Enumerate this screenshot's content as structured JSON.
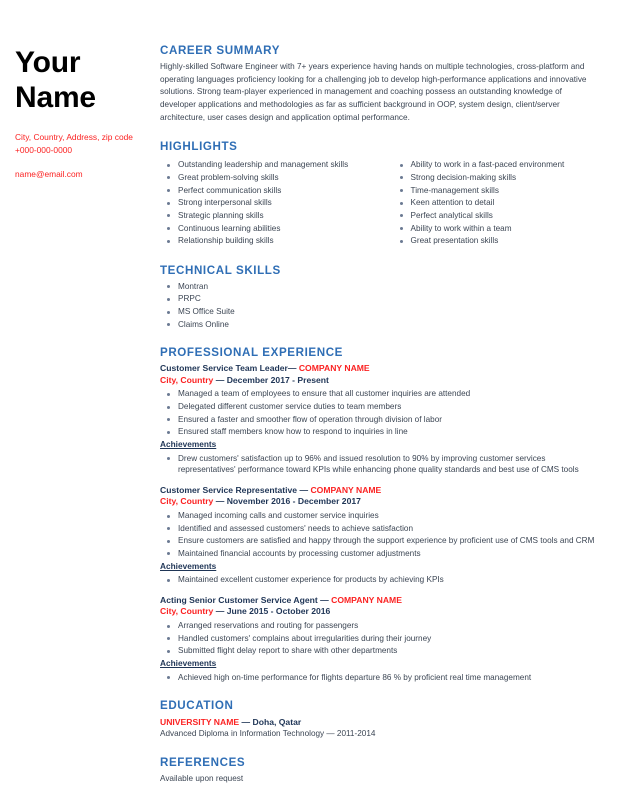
{
  "header": {
    "name_line_1": "Your",
    "name_line_2": "Name",
    "address": "City, Country, Address, zip code",
    "phone": "+000-000-0000",
    "email": "name@email.com"
  },
  "colors": {
    "heading_blue": "#2f6eb5",
    "accent_red": "#fb2222",
    "body_gray": "#3c4654",
    "dark_navy": "#1f3556"
  },
  "career_summary": {
    "title": "CAREER SUMMARY",
    "text": "Highly-skilled Software Engineer with 7+ years experience having hands on multiple technologies, cross-platform and operating languages proficiency looking for a challenging job to  develop high-performance applications and innovative solutions. Strong team-player experienced in management and coaching possess an outstanding knowledge of  developer applications and methodologies as far as sufficient background in OOP, system design, client/server architecture, user cases design and application optimal performance."
  },
  "highlights": {
    "title": "HIGHLIGHTS",
    "column_left": [
      "Outstanding leadership and management skills",
      "Great problem-solving skills",
      "Perfect communication skills",
      "Strong interpersonal skills",
      "Strategic planning skills",
      "Continuous learning abilities",
      "Relationship building skills"
    ],
    "column_right": [
      "Ability to work in a fast-paced environment",
      "Strong decision-making skills",
      "Time-management skills",
      "Keen attention to detail",
      "Perfect analytical skills",
      "Ability to work within a team",
      "Great presentation skills"
    ]
  },
  "technical_skills": {
    "title": "TECHNICAL SKILLS",
    "items": [
      "Montran",
      "PRPC",
      "MS Office Suite",
      "Claims Online"
    ]
  },
  "professional_experience": {
    "title": "PROFESSIONAL EXPERIENCE",
    "achievements_label": "Achievements",
    "separator": "—",
    "jobs": [
      {
        "role": "Customer Service Team Leader",
        "company": "COMPANY NAME",
        "place": "City, Country",
        "dates": "December 2017 - Present",
        "duties": [
          "Managed a team of employees to ensure that all customer inquiries are attended",
          "Delegated different customer service duties to team members",
          "Ensured a faster and smoother flow of operation through division of labor",
          "Ensured staff members know how to respond to inquiries in line"
        ],
        "achievements": [
          "Drew customers' satisfaction up to 96% and issued resolution to 90% by improving customer services representatives' performance toward KPIs while enhancing phone quality standards and best use of CMS tools"
        ]
      },
      {
        "role": "Customer Service Representative ",
        "company": "COMPANY NAME",
        "place": "City, Country",
        "dates": "November 2016 - December 2017",
        "duties": [
          "Managed incoming calls and customer service inquiries",
          "Identified and assessed customers' needs to achieve satisfaction",
          "Ensure customers are satisfied and happy through the support experience by proficient use of CMS tools and CRM",
          "Maintained financial accounts by processing customer adjustments"
        ],
        "achievements": [
          "Maintained excellent customer experience for products by achieving KPIs"
        ]
      },
      {
        "role": "Acting Senior Customer Service Agent ",
        "company": "COMPANY NAME",
        "place": "City, Country",
        "dates": "June 2015 - October 2016",
        "duties": [
          "Arranged reservations and routing for passengers",
          "Handled customers' complains about irregularities during their journey",
          "Submitted flight delay report to share with other departments"
        ],
        "achievements": [
          "Achieved high on-time performance for flights departure 86 % by proficient real time management"
        ]
      }
    ]
  },
  "education": {
    "title": "EDUCATION",
    "university": "UNIVERSITY NAME",
    "separator": "—",
    "location": "Doha, Qatar",
    "degree_line": "Advanced Diploma in Information Technology — 2011-2014"
  },
  "references": {
    "title": "REFERENCES",
    "text": "Available upon request"
  }
}
